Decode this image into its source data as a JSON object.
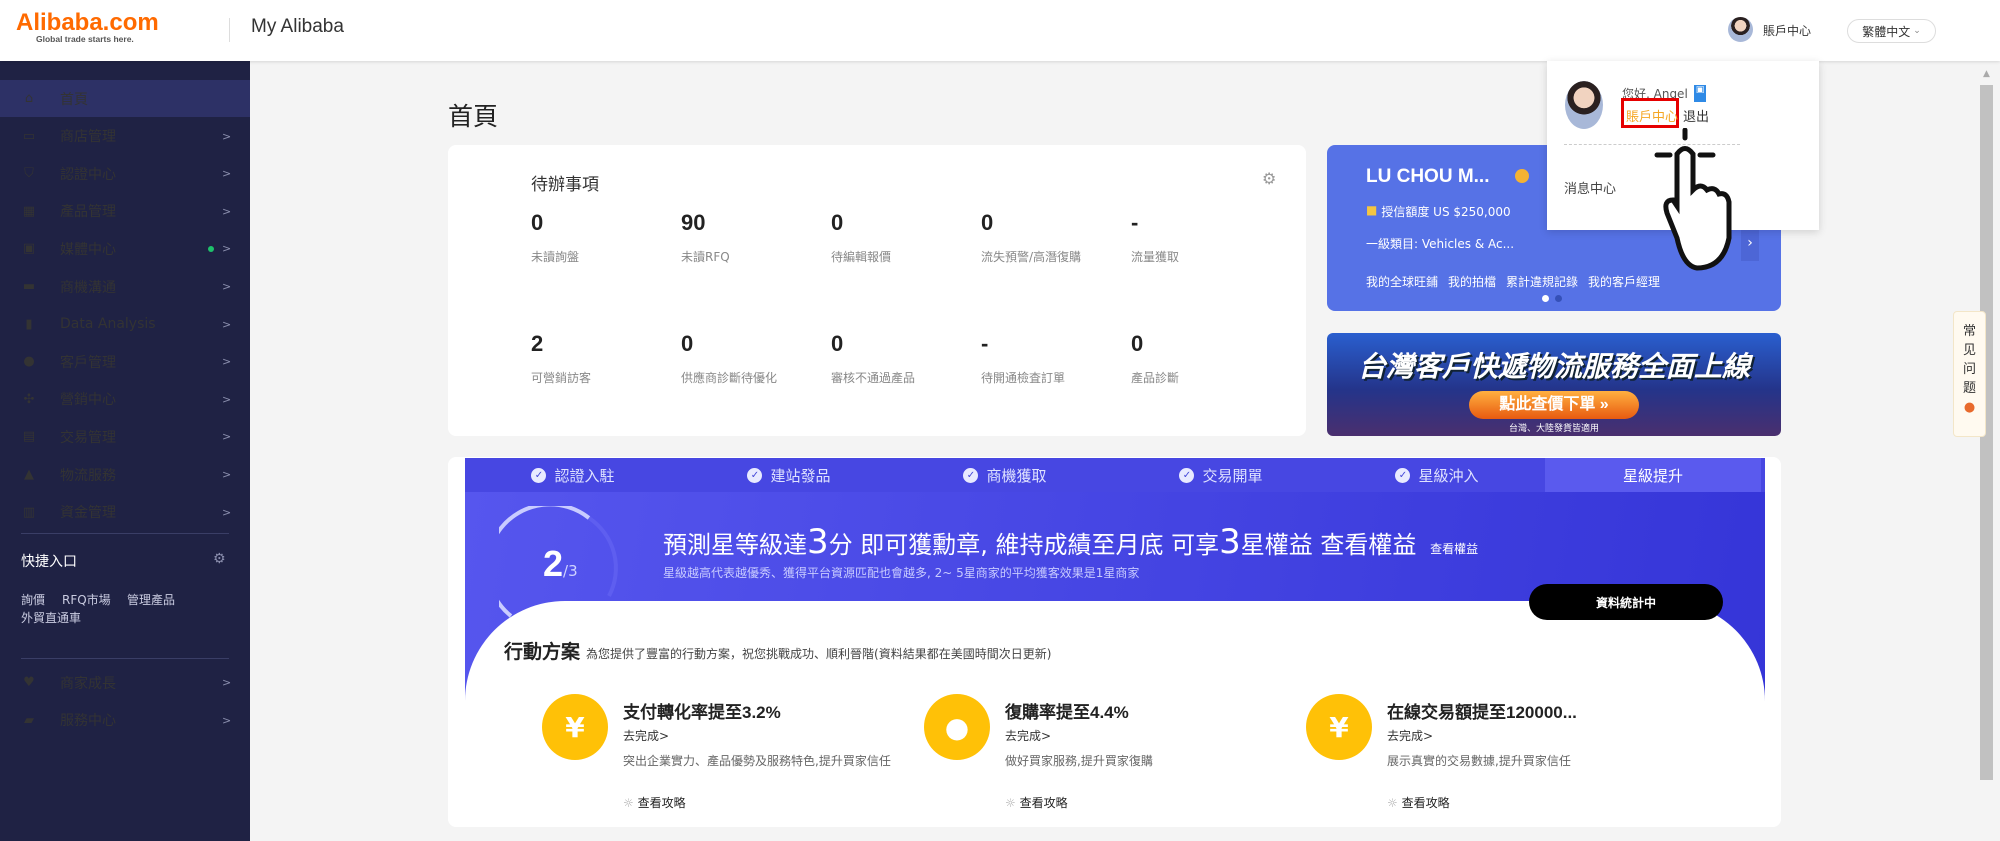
{
  "header": {
    "logo_text": "Alibaba.com",
    "logo_tagline": "Global trade starts here.",
    "app_title": "My Alibaba",
    "account_label": "賬戶中心",
    "language": "繁體中文"
  },
  "dropdown": {
    "greeting": "您好, Angel",
    "account_center": "賬戶中心",
    "logout": "退出",
    "message_center": "消息中心"
  },
  "sidebar": {
    "items": [
      {
        "icon": "home-icon",
        "label": "首頁"
      },
      {
        "icon": "store-icon",
        "label": "商店管理"
      },
      {
        "icon": "shield-icon",
        "label": "認證中心"
      },
      {
        "icon": "grid-icon",
        "label": "產品管理"
      },
      {
        "icon": "media-icon",
        "label": "媒體中心"
      },
      {
        "icon": "chat-icon",
        "label": "商機溝通"
      },
      {
        "icon": "bar-chart-icon",
        "label": "Data Analysis"
      },
      {
        "icon": "users-icon",
        "label": "客戶管理"
      },
      {
        "icon": "share-icon",
        "label": "營銷中心"
      },
      {
        "icon": "clipboard-icon",
        "label": "交易管理"
      },
      {
        "icon": "ship-icon",
        "label": "物流服務"
      },
      {
        "icon": "bank-icon",
        "label": "資金管理"
      }
    ],
    "quick_title": "快捷入口",
    "quick_links": [
      "詢價",
      "RFQ市場",
      "管理產品",
      "外貿直通車"
    ],
    "bottom_items": [
      {
        "icon": "heart-icon",
        "label": "商家成長"
      },
      {
        "icon": "briefcase-icon",
        "label": "服務中心"
      }
    ]
  },
  "main": {
    "page_title": "首頁",
    "todo": {
      "title": "待辦事項",
      "items": [
        {
          "value": "0",
          "label": "未讀詢盤"
        },
        {
          "value": "90",
          "label": "未讀RFQ"
        },
        {
          "value": "0",
          "label": "待編輯報價"
        },
        {
          "value": "0",
          "label": "流失預警/高潛復購"
        },
        {
          "value": "-",
          "label": "流量獲取"
        },
        {
          "value": "2",
          "label": "可營銷訪客"
        },
        {
          "value": "0",
          "label": "供應商診斷待優化"
        },
        {
          "value": "0",
          "label": "審核不通過產品"
        },
        {
          "value": "-",
          "label": "待開通檢査訂單"
        },
        {
          "value": "0",
          "label": "產品診斷"
        }
      ]
    },
    "company": {
      "name": "LU CHOU M...",
      "credit": "授信額度 US $250,000",
      "category": "一級類目: Vehicles & Ac...",
      "links": [
        "我的全球旺鋪",
        "我的拍檔",
        "累計違規記錄",
        "我的客戶經理"
      ]
    },
    "banner": {
      "headline": "台灣客戶快遞物流服務全面上線",
      "button": "點此查價下單 »",
      "footnote": "台灣、大陸發貨皆適用"
    },
    "star": {
      "steps": [
        "認證入駐",
        "建站發品",
        "商機獲取",
        "交易開單",
        "星級沖入",
        "星級提升"
      ],
      "score": "2",
      "score_total": "/3",
      "headline_parts": [
        "預測星等級達",
        "3",
        "分 即可獲勳章, 維持成績至月底 可享",
        "3",
        "星權益 查看權益"
      ],
      "view_link": "查看權益",
      "subtext": "星級越高代表越優秀、獲得平台資源匹配也會越多, 2~ 5星商家的平均獲客效果是1星商家",
      "status_button": "資料統計中"
    },
    "actions": {
      "title": "行動方案",
      "subtitle": "為您提供了豐富的行動方案，祝您挑戰成功、順利晉階(資料結果都在美國時間次日更新)",
      "items": [
        {
          "icon": "yen-cycle-icon",
          "title": "支付轉化率提至3.2%",
          "go": "去完成>",
          "desc": "突出企業實力、產品優勢及服務特色,提升買家信任",
          "guide": "查看攻略"
        },
        {
          "icon": "buyer-icon",
          "title": "復購率提至4.4%",
          "go": "去完成>",
          "desc": "做好買家服務,提升買家復購",
          "guide": "查看攻略"
        },
        {
          "icon": "yen-chart-icon",
          "title": "在線交易額提至120000...",
          "go": "去完成>",
          "desc": "展示真實的交易數據,提升買家信任",
          "guide": "查看攻略"
        }
      ]
    }
  },
  "faq": {
    "label": "常见问题"
  },
  "colors": {
    "sidebar": "#1f2244",
    "active": "#2d3166",
    "brand": "#ff6a00",
    "blue": "#3f3fe0",
    "yellow": "#ffc107"
  }
}
